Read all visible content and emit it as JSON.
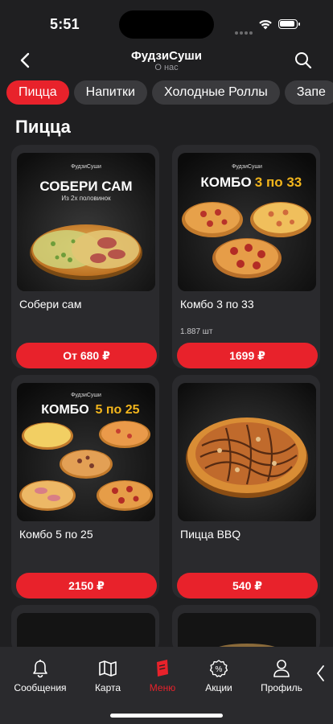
{
  "status_bar": {
    "time": "5:51"
  },
  "header": {
    "title": "ФудзиСуши",
    "subtitle": "О нас"
  },
  "categories": [
    {
      "label": "Пицца",
      "active": true
    },
    {
      "label": "Напитки",
      "active": false
    },
    {
      "label": "Холодные Роллы",
      "active": false
    },
    {
      "label": "Запе",
      "active": false
    }
  ],
  "section_title": "Пицца",
  "products": [
    {
      "name": "Собери сам",
      "price": "От 680 ₽",
      "note": "",
      "image": {
        "brand": "ФудзиСуши",
        "headline": "СОБЕРИ САМ",
        "subline": "Из 2х половинок"
      }
    },
    {
      "name": "Комбо 3 по 33",
      "price": "1699 ₽",
      "note": "1.887 шт",
      "image": {
        "brand": "ФудзиСуши",
        "headline": "КОМБО",
        "accent": "3 по 33"
      }
    },
    {
      "name": "Комбо 5 по 25",
      "price": "2150 ₽",
      "note": "",
      "image": {
        "brand": "ФудзиСуши",
        "headline": "КОМБО",
        "accent": "5 по 25"
      }
    },
    {
      "name": "Пицца BBQ",
      "price": "540 ₽",
      "note": "",
      "image": {}
    }
  ],
  "tabbar": {
    "items": [
      {
        "label": "Сообщения",
        "icon": "bell-icon",
        "active": false
      },
      {
        "label": "Карта",
        "icon": "map-icon",
        "active": false
      },
      {
        "label": "Меню",
        "icon": "menu-icon",
        "active": true
      },
      {
        "label": "Акции",
        "icon": "discount-icon",
        "active": false
      },
      {
        "label": "Профиль",
        "icon": "profile-icon",
        "active": false
      }
    ]
  },
  "colors": {
    "accent": "#e8222b",
    "background": "#1f1f21",
    "card": "#2a2a2d",
    "chip": "#3a3a3d"
  }
}
